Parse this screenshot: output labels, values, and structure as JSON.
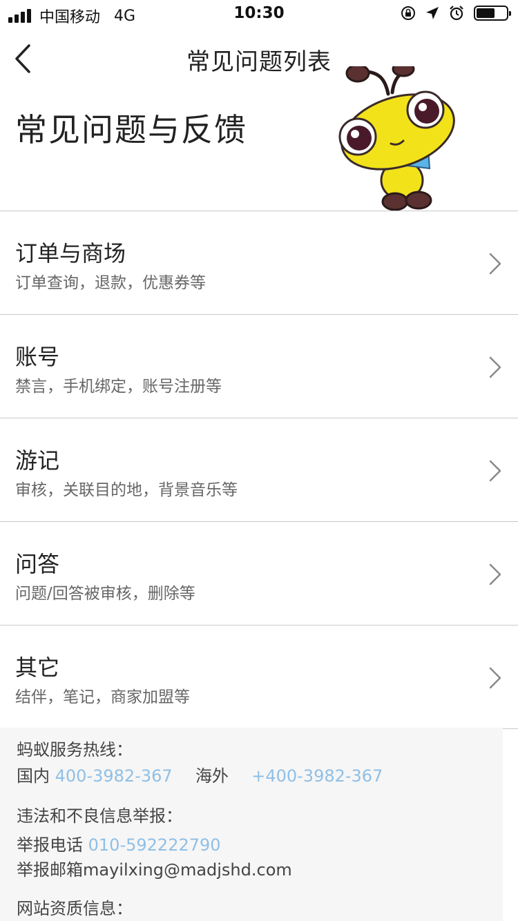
{
  "status_bar": {
    "carrier": "中国移动",
    "network": "4G",
    "time": "10:30"
  },
  "nav": {
    "title": "常见问题列表",
    "back_icon": "chevron-left-icon"
  },
  "hero": {
    "title": "常见问题与反馈"
  },
  "faq_items": [
    {
      "title": "订单与商场",
      "desc": "订单查询，退款，优惠券等"
    },
    {
      "title": "账号",
      "desc": "禁言，手机绑定，账号注册等"
    },
    {
      "title": "游记",
      "desc": "审核，关联目的地，背景音乐等"
    },
    {
      "title": "问答",
      "desc": "问题/回答被审核，删除等"
    },
    {
      "title": "其它",
      "desc": "结伴，笔记，商家加盟等"
    }
  ],
  "info": {
    "hotline_label": "蚂蚁服务热线：",
    "domestic_label": "国内",
    "domestic_phone": "400-3982-367",
    "overseas_label": "海外",
    "overseas_phone": "+400-3982-367",
    "report_label": "违法和不良信息举报：",
    "report_phone_label": "举报电话",
    "report_phone": "010-592222790",
    "report_email": "举报邮箱mayilxing@madjshd.com",
    "qualification_label": "网站资质信息："
  },
  "colors": {
    "link": "#8fbfe6",
    "divider": "#c8c8c8",
    "info_bg": "#f6f6f6"
  }
}
